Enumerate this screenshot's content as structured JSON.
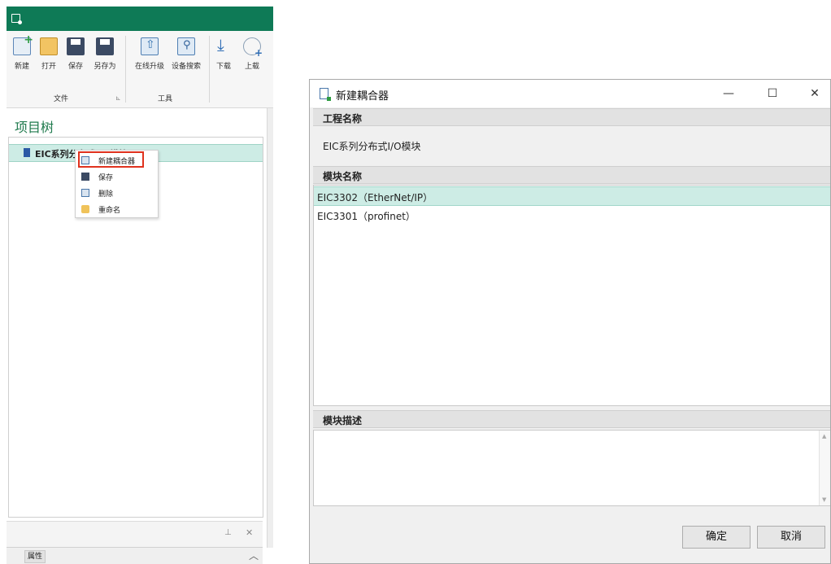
{
  "ribbon": {
    "buttons": [
      "新建",
      "打开",
      "保存",
      "另存为",
      "在线升级",
      "设备搜索",
      "下载",
      "上载"
    ],
    "groups": [
      "文件",
      "工具"
    ]
  },
  "project_tree": {
    "title": "项目树",
    "root_label": "EIC系列分布式I/O模块"
  },
  "context_menu": {
    "items": [
      "新建耦合器",
      "保存",
      "删除",
      "重命名"
    ]
  },
  "properties_panel": {
    "tab": "属性"
  },
  "dialog": {
    "title": "新建耦合器",
    "project_name_label": "工程名称",
    "project_name_value": "EIC系列分布式I/O模块",
    "module_name_label": "模块名称",
    "modules": [
      "EIC3302（EtherNet/IP）",
      "EIC3301（profinet）"
    ],
    "selected_module": "EIC3302（EtherNet/IP）",
    "module_desc_label": "模块描述",
    "ok_label": "确定",
    "cancel_label": "取消",
    "window_buttons": [
      "—",
      "☐",
      "✕"
    ]
  },
  "colors": {
    "titlebar": "#0e7a56",
    "selection": "#cdece5",
    "highlight_box": "#e0321e"
  }
}
